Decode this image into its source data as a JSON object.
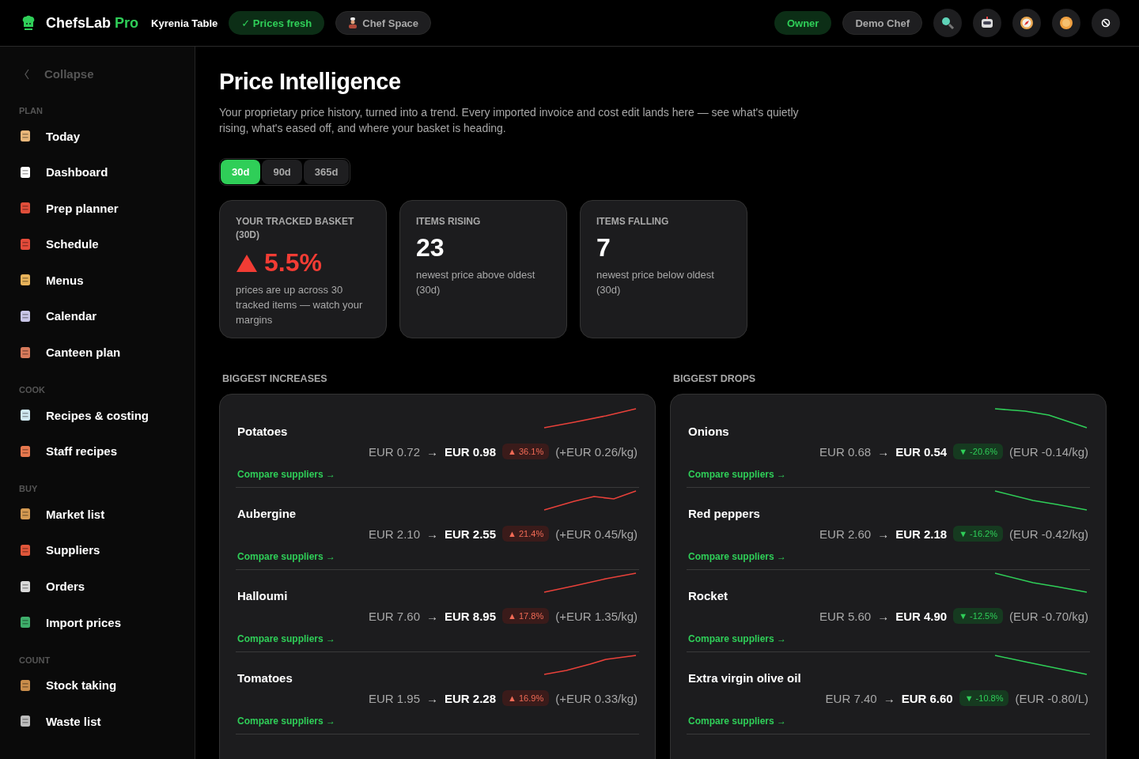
{
  "app": {
    "name": "ChefsLab",
    "edition": "Pro",
    "venue": "Kyrenia Table",
    "status": "✓ Prices fresh",
    "space": "Chef Space"
  },
  "user": {
    "role": "Owner",
    "name": "Demo Chef"
  },
  "sidebar": {
    "collapse": "Collapse",
    "sections": [
      {
        "title": "PLAN",
        "items": [
          {
            "label": "Today"
          },
          {
            "label": "Dashboard"
          },
          {
            "label": "Prep planner"
          },
          {
            "label": "Schedule"
          },
          {
            "label": "Menus"
          },
          {
            "label": "Calendar"
          },
          {
            "label": "Canteen plan"
          }
        ]
      },
      {
        "title": "COOK",
        "items": [
          {
            "label": "Recipes & costing"
          },
          {
            "label": "Staff recipes"
          }
        ]
      },
      {
        "title": "BUY",
        "items": [
          {
            "label": "Market list"
          },
          {
            "label": "Suppliers"
          },
          {
            "label": "Orders"
          },
          {
            "label": "Import prices"
          }
        ]
      },
      {
        "title": "COUNT",
        "items": [
          {
            "label": "Stock taking"
          },
          {
            "label": "Waste list"
          }
        ]
      }
    ]
  },
  "page": {
    "title": "Price Intelligence",
    "description": "Your proprietary price history, turned into a trend. Every imported invoice and cost edit lands here — see what's quietly rising, what's eased off, and where your basket is heading.",
    "ranges": [
      {
        "label": "30d",
        "selected": true
      },
      {
        "label": "90d",
        "selected": false
      },
      {
        "label": "365d",
        "selected": false
      }
    ],
    "stats": [
      {
        "kind": "trend_up",
        "label": "YOUR TRACKED BASKET (30D)",
        "value": "5.5%",
        "caption": "prices are up across 30 tracked items — watch your margins"
      },
      {
        "kind": "count",
        "label": "ITEMS RISING",
        "value": "23",
        "caption": "newest price above oldest (30d)"
      },
      {
        "kind": "count",
        "label": "ITEMS FALLING",
        "value": "7",
        "caption": "newest price below oldest (30d)"
      }
    ],
    "columns": [
      {
        "title": "BIGGEST INCREASES",
        "kind": "rising",
        "rows": [
          {
            "name": "Potatoes",
            "from": "EUR 0.72",
            "arrow": "→",
            "to": "EUR 0.98",
            "change": "▲ 36.1%",
            "delta": "(+EUR 0.26/kg)",
            "link": "Compare suppliers →"
          },
          {
            "name": "Aubergine",
            "from": "EUR 2.10",
            "arrow": "→",
            "to": "EUR 2.55",
            "change": "▲ 21.4%",
            "delta": "(+EUR 0.45/kg)",
            "link": "Compare suppliers →"
          },
          {
            "name": "Halloumi",
            "from": "EUR 7.60",
            "arrow": "→",
            "to": "EUR 8.95",
            "change": "▲ 17.8%",
            "delta": "(+EUR 1.35/kg)",
            "link": "Compare suppliers →"
          },
          {
            "name": "Tomatoes",
            "from": "EUR 1.95",
            "arrow": "→",
            "to": "EUR 2.28",
            "change": "▲ 16.9%",
            "delta": "(+EUR 0.33/kg)",
            "link": "Compare suppliers →"
          }
        ]
      },
      {
        "title": "BIGGEST DROPS",
        "kind": "falling",
        "rows": [
          {
            "name": "Onions",
            "from": "EUR 0.68",
            "arrow": "→",
            "to": "EUR 0.54",
            "change": "▼ -20.6%",
            "delta": "(EUR -0.14/kg)",
            "link": "Compare suppliers →"
          },
          {
            "name": "Red peppers",
            "from": "EUR 2.60",
            "arrow": "→",
            "to": "EUR 2.18",
            "change": "▼ -16.2%",
            "delta": "(EUR -0.42/kg)",
            "link": "Compare suppliers →"
          },
          {
            "name": "Rocket",
            "from": "EUR 5.60",
            "arrow": "→",
            "to": "EUR 4.90",
            "change": "▼ -12.5%",
            "delta": "(EUR -0.70/kg)",
            "link": "Compare suppliers →"
          },
          {
            "name": "Extra virgin olive oil",
            "from": "EUR 7.40",
            "arrow": "→",
            "to": "EUR 6.60",
            "change": "▼ -10.8%",
            "delta": "(EUR -0.80/L)",
            "link": "Compare suppliers →"
          }
        ]
      }
    ]
  }
}
